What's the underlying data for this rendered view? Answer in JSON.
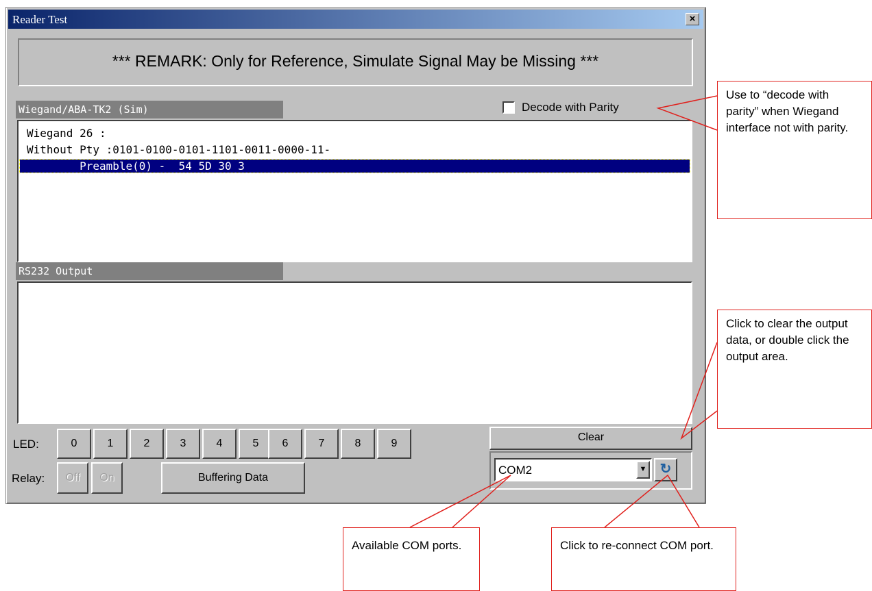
{
  "window": {
    "title": "Reader Test",
    "close_glyph": "×"
  },
  "remark": "*** REMARK: Only for Reference, Simulate Signal May be Missing ***",
  "wiegand": {
    "group_label": "Wiegand/ABA-TK2 (Sim)",
    "decode_checkbox_label": "Decode with Parity",
    "decode_checked": false,
    "lines": [
      "Wiegand 26 :",
      "Without Pty :0101-0100-0101-1101-0011-0000-11-",
      "        Preamble(0) -  54 5D 30 3"
    ],
    "selected_index": 2
  },
  "rs232": {
    "group_label": "RS232 Output",
    "lines": []
  },
  "led": {
    "label": "LED:",
    "buttons": [
      "0",
      "1",
      "2",
      "3",
      "4",
      "5",
      "6",
      "7",
      "8",
      "9"
    ]
  },
  "relay": {
    "label": "Relay:",
    "off_label": "Off",
    "on_label": "On"
  },
  "buffering_label": "Buffering Data",
  "clear_label": "Clear",
  "com": {
    "selected": "COM2",
    "refresh_icon": "refresh-icon"
  },
  "callouts": {
    "parity": "Use to “decode with parity” when Wiegand interface not with parity.",
    "clear": "Click to clear the output data, or double click the output area.",
    "ports": "Available COM ports.",
    "reconnect": "Click to re-connect COM port."
  },
  "colors": {
    "callout_border": "#e0201c",
    "selection": "#000080",
    "title_bar": "#0a246a"
  }
}
